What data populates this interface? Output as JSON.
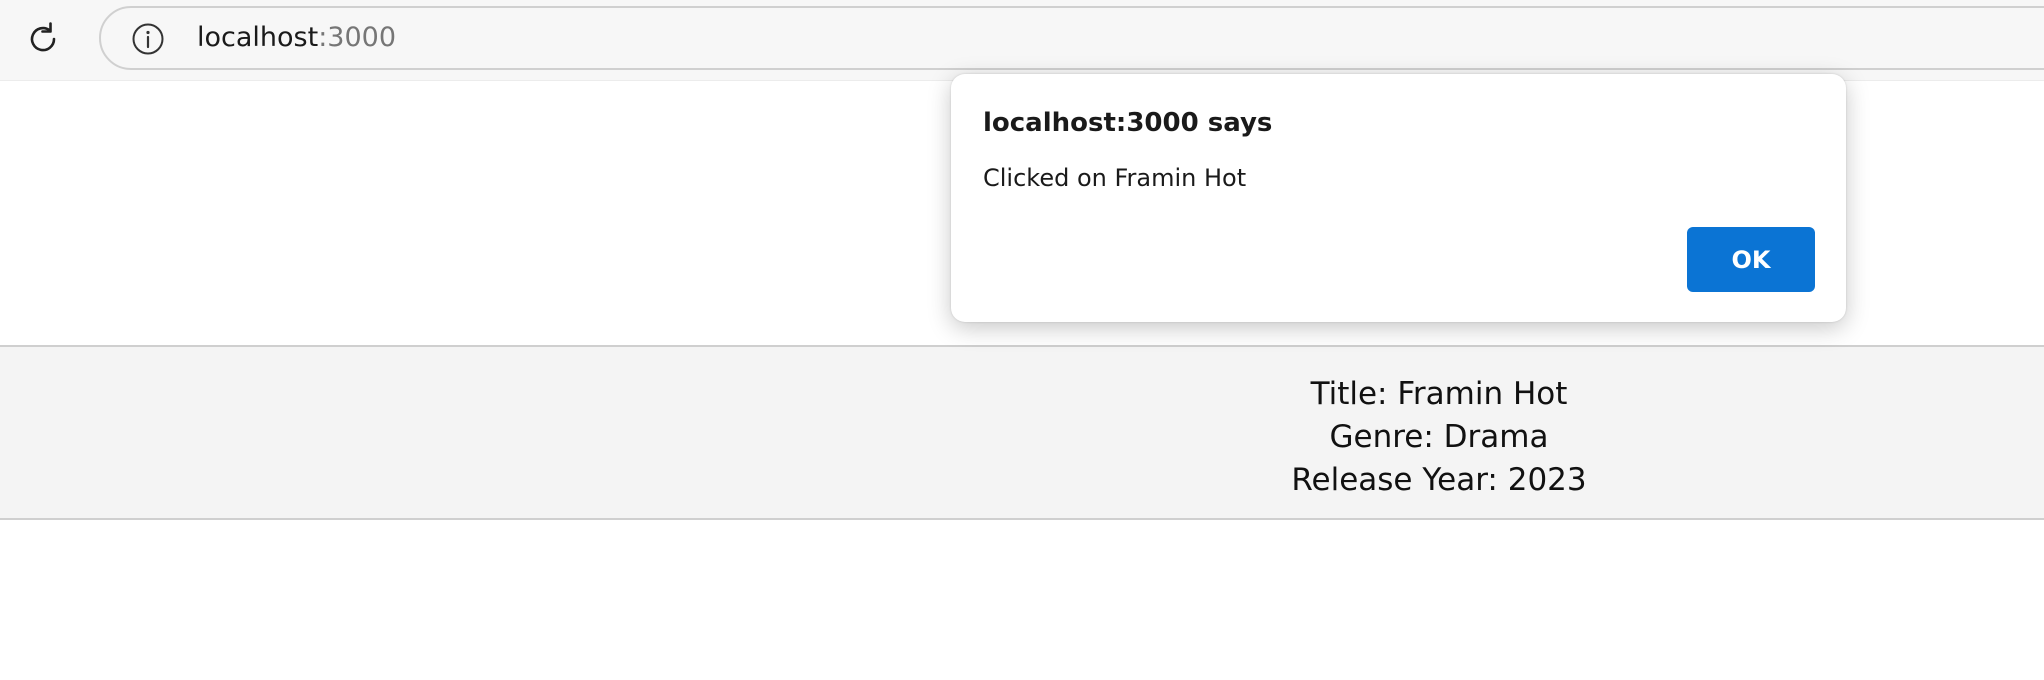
{
  "browser": {
    "address_bar": {
      "host": "localhost",
      "port": ":3000"
    }
  },
  "movie": {
    "title_line": "Title: Framin Hot",
    "genre_line": "Genre: Drama",
    "year_line": "Release Year: 2023"
  },
  "alert_dialog": {
    "title": "localhost:3000 says",
    "message": "Clicked on Framin Hot",
    "ok_label": "OK"
  },
  "colors": {
    "ok_button": "#0b74d4",
    "row_background": "#f4f4f4"
  }
}
